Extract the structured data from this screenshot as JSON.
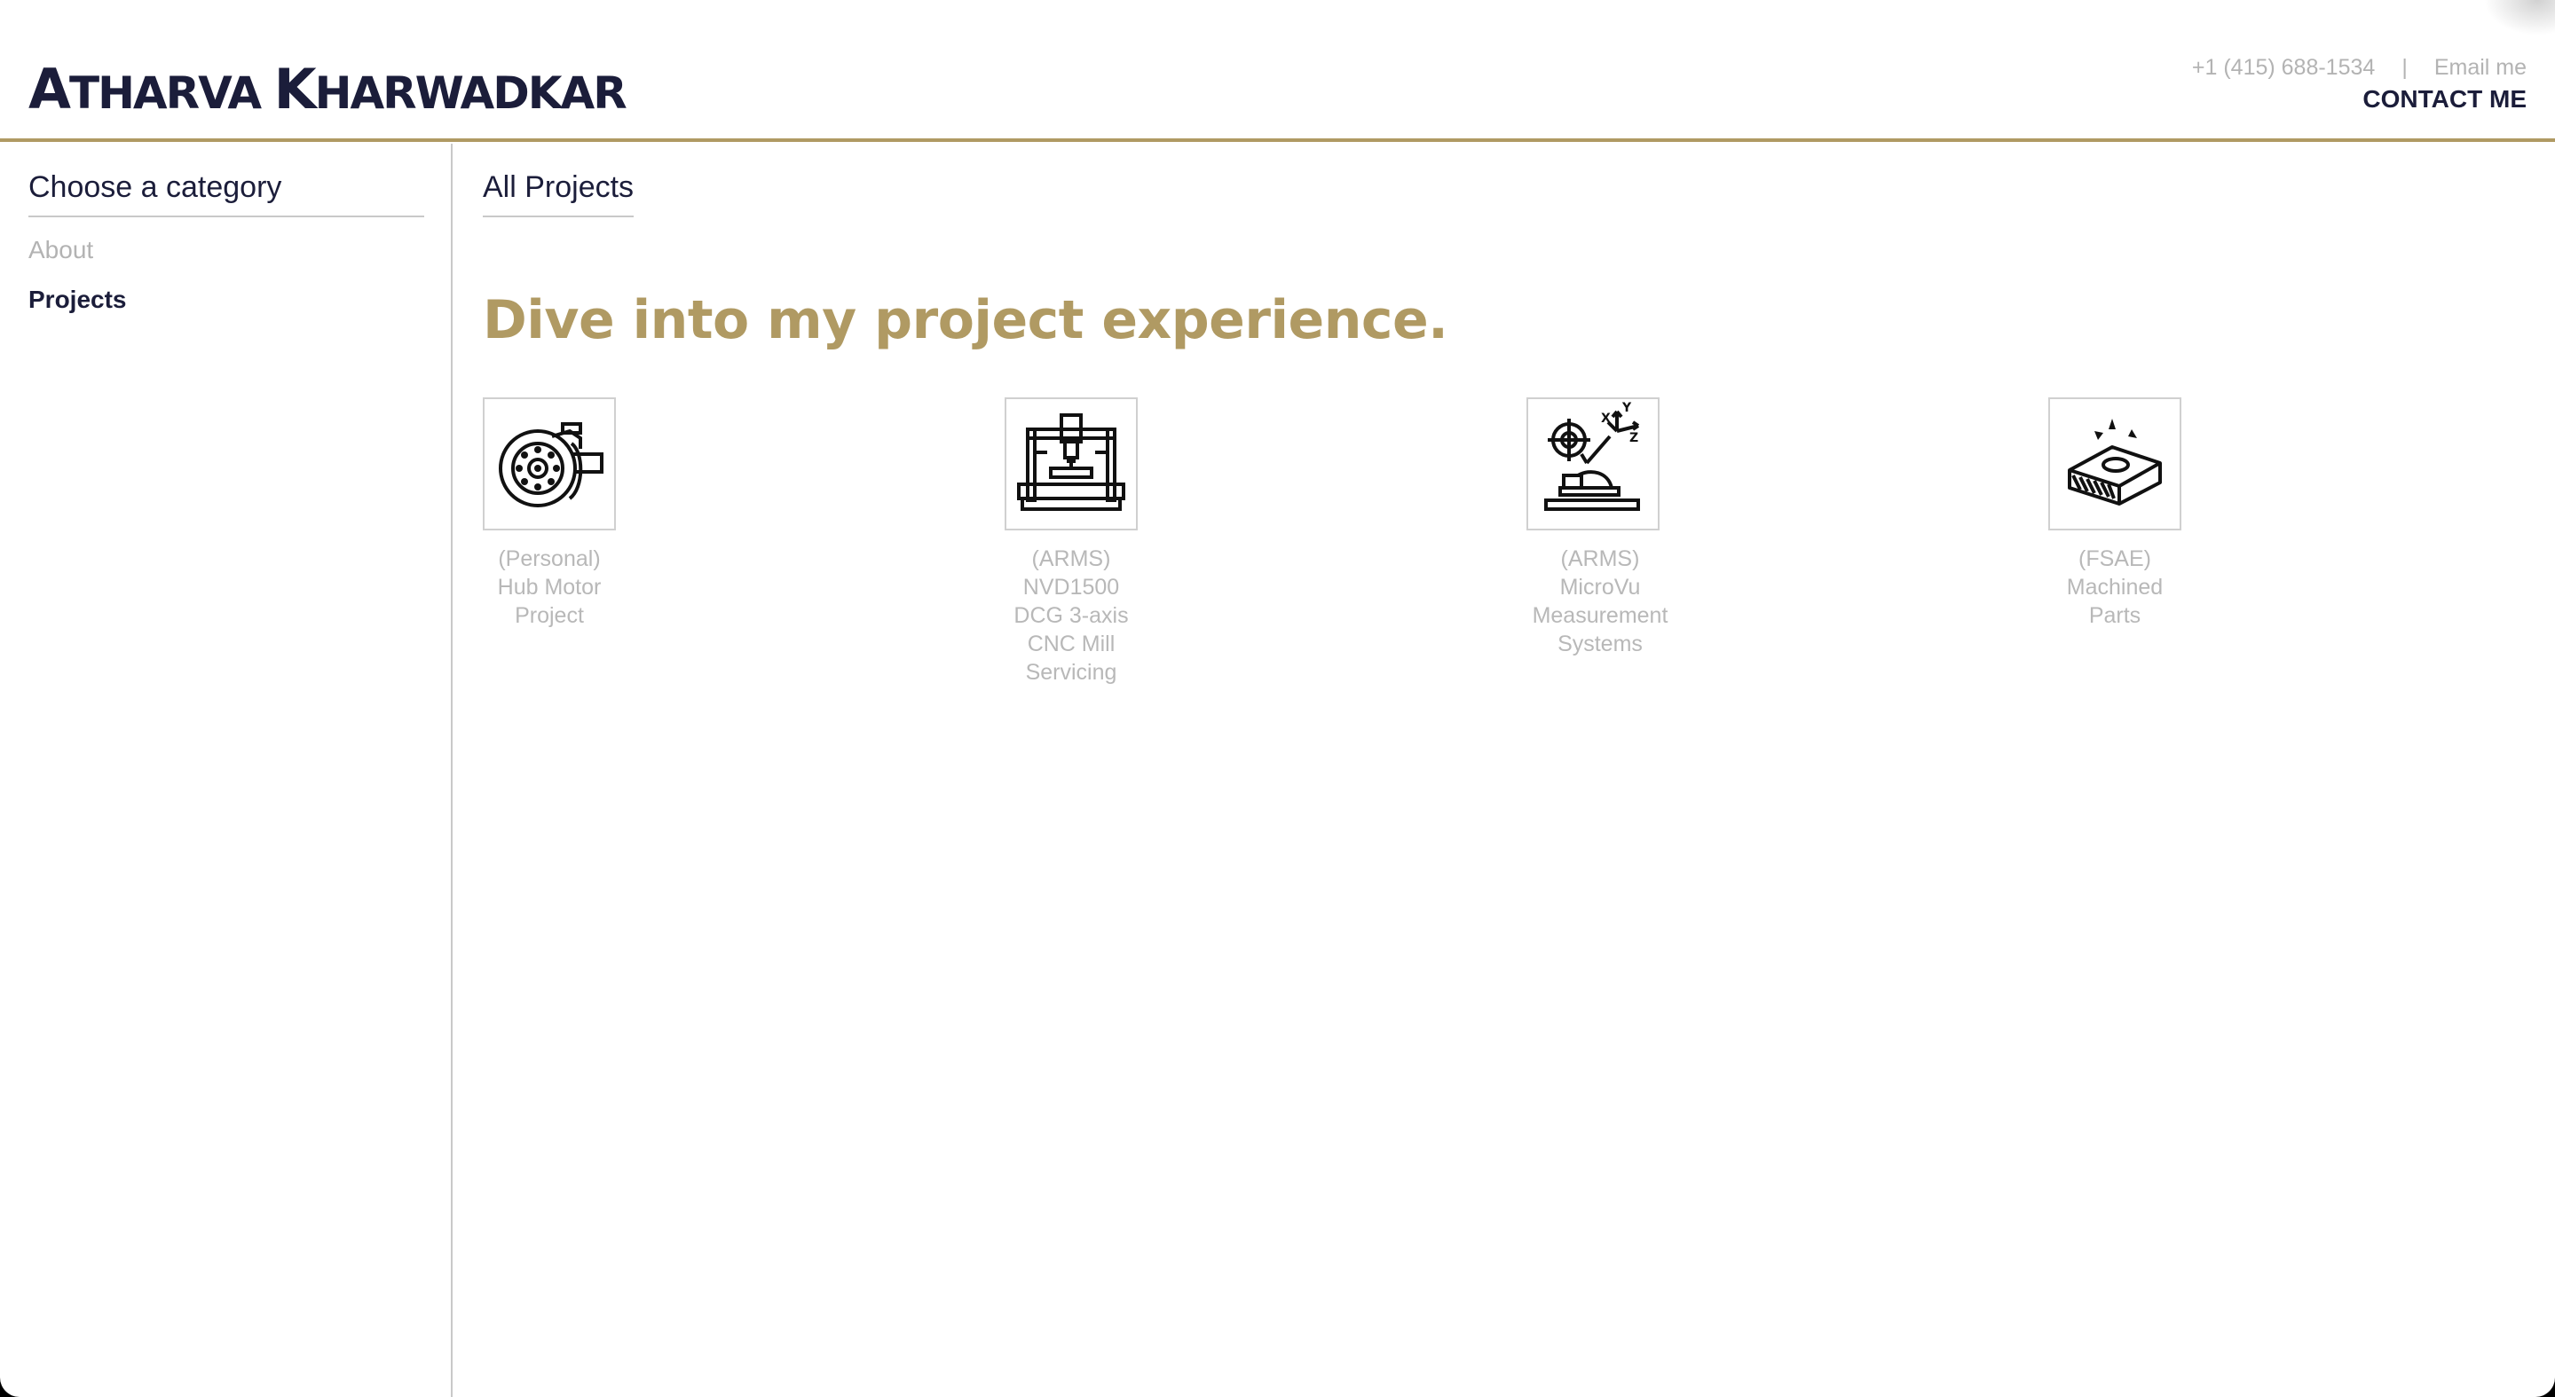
{
  "header": {
    "brand_first_initial": "A",
    "brand_first_rest": "THARVA",
    "brand_last_initial": "K",
    "brand_last_rest": "HARWADKAR",
    "phone": "+1 (415) 688-1534",
    "separator": "|",
    "email_label": "Email me",
    "contact_label": "CONTACT ME"
  },
  "sidebar": {
    "title": "Choose a category",
    "items": [
      {
        "label": "About",
        "active": false
      },
      {
        "label": "Projects",
        "active": true
      }
    ]
  },
  "main": {
    "tab_label": "All Projects",
    "headline": "Dive into my project experience.",
    "projects": [
      {
        "icon": "hub-motor-icon",
        "lines": [
          "(Personal)",
          "Hub Motor",
          "Project"
        ]
      },
      {
        "icon": "cnc-mill-icon",
        "lines": [
          "(ARMS)",
          "NVD1500",
          "DCG 3-axis",
          "CNC Mill",
          "Servicing"
        ]
      },
      {
        "icon": "measurement-system-icon",
        "lines": [
          "(ARMS)",
          "MicroVu",
          "Measurement",
          "Systems"
        ]
      },
      {
        "icon": "machined-part-icon",
        "lines": [
          "(FSAE)",
          "Machined",
          "Parts"
        ]
      }
    ]
  },
  "colors": {
    "accent_gold": "#b09a63",
    "navy": "#1b1d3a",
    "muted_gray": "#b3b3b3"
  }
}
